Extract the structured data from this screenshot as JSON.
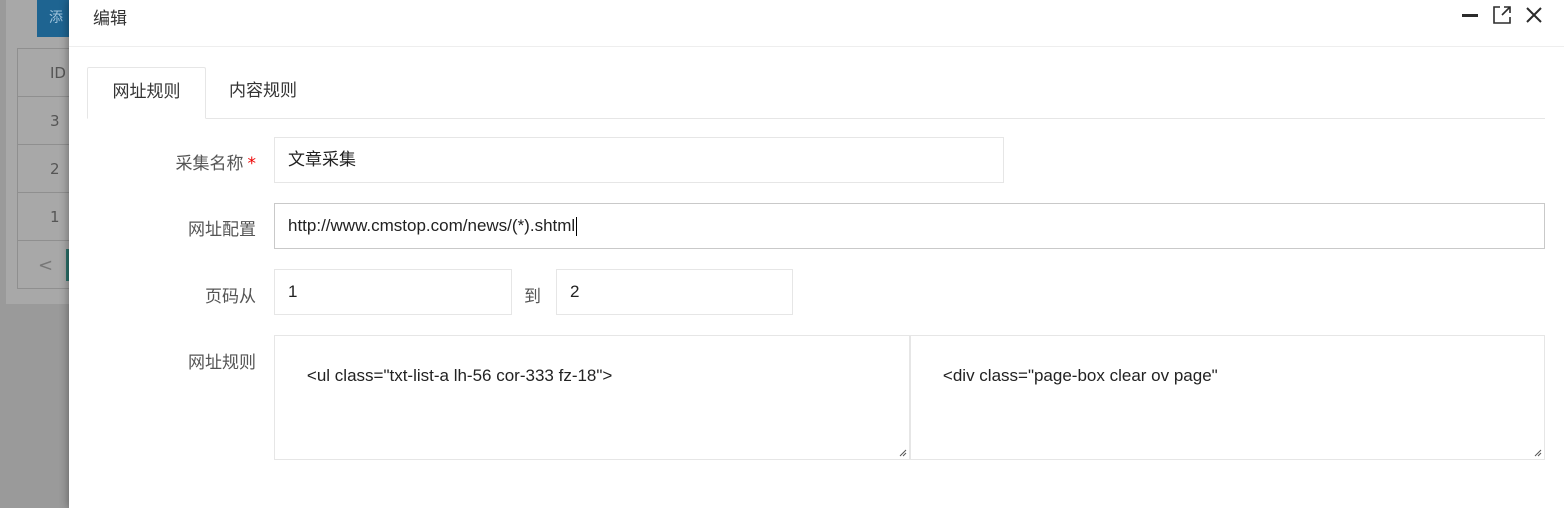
{
  "background": {
    "add_button_label": "添",
    "table_header": "ID",
    "row_ids": [
      "3",
      "2",
      "1"
    ],
    "pager_prev": "<"
  },
  "modal": {
    "title": "编辑",
    "controls": {
      "minimize": "minimize-icon",
      "maximize": "maximize-icon",
      "close": "close-icon"
    }
  },
  "tabs": [
    {
      "label": "网址规则",
      "active": true
    },
    {
      "label": "内容规则",
      "active": false
    }
  ],
  "form": {
    "name_label": "采集名称",
    "name_required": "*",
    "name_value": "文章采集",
    "url_label": "网址配置",
    "url_value": "http://www.cmstop.com/news/(*).shtml",
    "page_label": "页码从",
    "page_from": "1",
    "page_to_label": "到",
    "page_to": "2",
    "rule_label": "网址规则",
    "rule_start": "<ul class=\"txt-list-a lh-56 cor-333 fz-18\">",
    "rule_end": "<div class=\"page-box clear ov page\""
  },
  "colors": {
    "required": "#ee0000",
    "dim_overlay": "#9a9a9a",
    "primary_button": "#1e6491"
  }
}
